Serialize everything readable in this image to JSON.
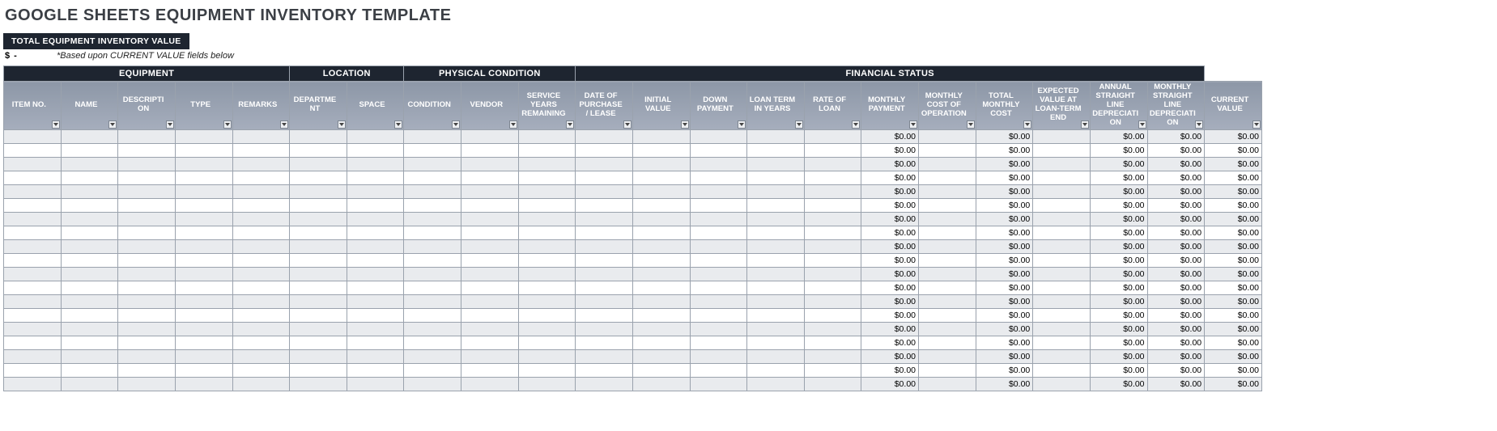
{
  "title": "GOOGLE SHEETS EQUIPMENT INVENTORY TEMPLATE",
  "total_box_label": "TOTAL EQUIPMENT INVENTORY VALUE",
  "total_value": "$        -",
  "total_note": "*Based upon CURRENT VALUE fields below",
  "group_headers": [
    {
      "label": "EQUIPMENT",
      "span": 5
    },
    {
      "label": "LOCATION",
      "span": 2
    },
    {
      "label": "PHYSICAL CONDITION",
      "span": 3
    },
    {
      "label": "FINANCIAL STATUS",
      "span": 11
    }
  ],
  "columns": [
    {
      "key": "item_no",
      "label": "ITEM NO.",
      "cls": "w-sm"
    },
    {
      "key": "name",
      "label": "NAME",
      "cls": "w-xs"
    },
    {
      "key": "description",
      "label": "DESCRIPTION",
      "cls": "w-lg"
    },
    {
      "key": "type",
      "label": "TYPE",
      "cls": "w-sm"
    },
    {
      "key": "remarks",
      "label": "REMARKS",
      "cls": "w-md"
    },
    {
      "key": "department",
      "label": "DEPARTMENT",
      "cls": "w-md"
    },
    {
      "key": "space",
      "label": "SPACE",
      "cls": "w-xs"
    },
    {
      "key": "condition",
      "label": "CONDITION",
      "cls": "w-md"
    },
    {
      "key": "vendor",
      "label": "VENDOR",
      "cls": "w-md"
    },
    {
      "key": "service_years",
      "label": "SERVICE YEARS REMAINING",
      "cls": "w-md"
    },
    {
      "key": "purchase_date",
      "label": "DATE OF PURCHASE / LEASE",
      "cls": "w-md"
    },
    {
      "key": "initial_value",
      "label": "INITIAL VALUE",
      "cls": "w-sm"
    },
    {
      "key": "down_payment",
      "label": "DOWN PAYMENT",
      "cls": "w-md"
    },
    {
      "key": "loan_term",
      "label": "LOAN TERM IN YEARS",
      "cls": "w-md"
    },
    {
      "key": "rate",
      "label": "RATE OF LOAN",
      "cls": "w-sm"
    },
    {
      "key": "monthly_payment",
      "label": "MONTHLY PAYMENT",
      "cls": "w-md",
      "money": true
    },
    {
      "key": "monthly_op_cost",
      "label": "MONTHLY COST OF OPERATION",
      "cls": "w-md"
    },
    {
      "key": "total_monthly_cost",
      "label": "TOTAL MONTHLY COST",
      "cls": "w-md",
      "money": true
    },
    {
      "key": "expected_end_value",
      "label": "EXPECTED VALUE AT LOAN-TERM END",
      "cls": "w-md"
    },
    {
      "key": "annual_dep",
      "label": "ANNUAL STRAIGHT LINE DEPRECIATION",
      "cls": "w-lg",
      "money": true
    },
    {
      "key": "monthly_dep",
      "label": "MONTHLY STRAIGHT LINE DEPRECIATION",
      "cls": "w-lg",
      "money": true
    },
    {
      "key": "current_value",
      "label": "CURRENT VALUE",
      "cls": "w-md",
      "money": true
    }
  ],
  "default_money": "$0.00",
  "row_count": 19
}
